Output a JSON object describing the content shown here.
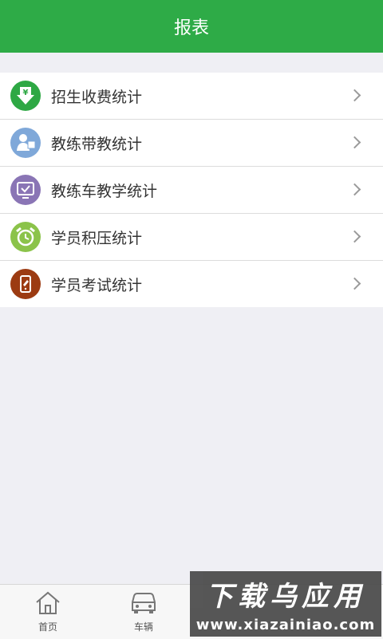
{
  "header": {
    "title": "报表"
  },
  "menu": [
    {
      "label": "招生收费统计",
      "icon": "yen-download-icon",
      "color": "#2ea844"
    },
    {
      "label": "教练带教统计",
      "icon": "instructor-icon",
      "color": "#7fa8d9"
    },
    {
      "label": "教练车教学统计",
      "icon": "screen-check-icon",
      "color": "#8a75b5"
    },
    {
      "label": "学员积压统计",
      "icon": "alarm-clock-icon",
      "color": "#8bc34a"
    },
    {
      "label": "学员考试统计",
      "icon": "exam-phone-icon",
      "color": "#9c3b12"
    }
  ],
  "tabbar": [
    {
      "label": "首页",
      "icon": "home-icon"
    },
    {
      "label": "车辆",
      "icon": "car-icon"
    }
  ],
  "watermark": {
    "line1": "下载乌应用",
    "line2": "www.xiazainiao.com"
  },
  "colors": {
    "accent": "#2eab47",
    "background": "#efeff4"
  }
}
